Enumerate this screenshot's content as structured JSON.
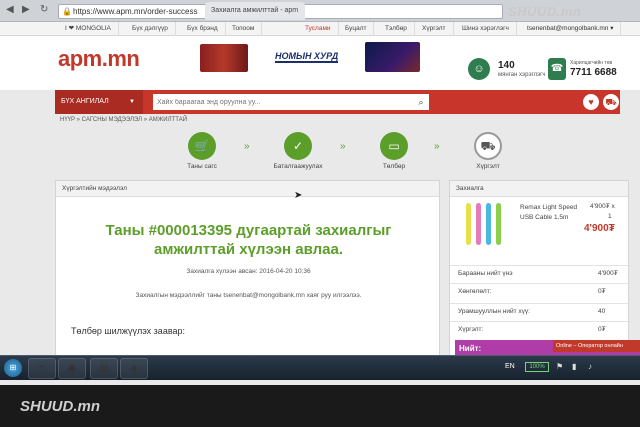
{
  "browser": {
    "tab_title": "Захиалга амжилттай - apm",
    "url": "https://www.apm.mn/order-success",
    "watermark": "SHUUD.mn"
  },
  "menu": {
    "items": [
      "I ❤ MONGOLIA",
      "Бүх дэлгүүр",
      "Бүх брэнд",
      "Топоом",
      "Туслами",
      "Буцалт",
      "Тэлбөр",
      "Хүргэлт",
      "Шинэ хэрэглэгч"
    ],
    "account": "tsenenbat@mongolbank.mn ▾"
  },
  "header": {
    "logo": "apm.mn",
    "banner_text": "НОМЫН ХУРД",
    "users_count": "140",
    "users_label": "мянган хэрэглэгч",
    "phone_label": "Харилцагчийн төв",
    "phone_number": "7711 6688"
  },
  "search": {
    "category_label": "БҮХ АНГИЛАЛ",
    "placeholder": "Хайх бараагаа энд оруулна уу..."
  },
  "breadcrumb": "НҮҮР » САГСНЫ МЭДЭЭЛЭЛ » АМЖИЛТТАЙ",
  "steps": [
    {
      "label": "Таны сагс",
      "icon": "cart-icon",
      "done": true
    },
    {
      "label": "Баталгаажуулах",
      "icon": "check-icon",
      "done": true
    },
    {
      "label": "Төлбөр",
      "icon": "card-icon",
      "done": true
    },
    {
      "label": "Хүргэлт",
      "icon": "truck-icon",
      "done": false
    }
  ],
  "order": {
    "panel_title": "Хүргэлтийн мэдээлэл",
    "success_line1": "Таны #000013395 дугаартай захиалгыг",
    "success_line2": "амжилттай хүлээн авлаа.",
    "date_line": "Захиалга хүлээн авсан: 2016-04-20 10:36",
    "email_line": "Захиалгын мэдээллийг таны tsenenbat@mongolbank.mn хаяг руу илгээлээ.",
    "pay_title": "Төлбөр шилжүүлэх заавар:"
  },
  "cart": {
    "title": "Захиалга",
    "product_name": "Remax Light Speed USB Cable 1.5m",
    "unit_price": "4'900₮ x",
    "qty": "1",
    "price": "4'900₮",
    "rows": [
      {
        "label": "Барааны нийт үнэ",
        "value": "4'900₮"
      },
      {
        "label": "Хөнгөлөлт:",
        "value": "0₮"
      },
      {
        "label": "Урамшууллын нийт хүү:",
        "value": "40"
      },
      {
        "label": "Хүргэлт:",
        "value": "0₮"
      }
    ]
  },
  "promo": {
    "label": "Нийт:",
    "chat": "Online – Оператор онлайн"
  },
  "taskbar": {
    "lang": "EN",
    "battery": "100%"
  },
  "colors": {
    "brand_red": "#c8352a",
    "success_green": "#5c9e2a",
    "promo_purple": "#b03ca8"
  }
}
